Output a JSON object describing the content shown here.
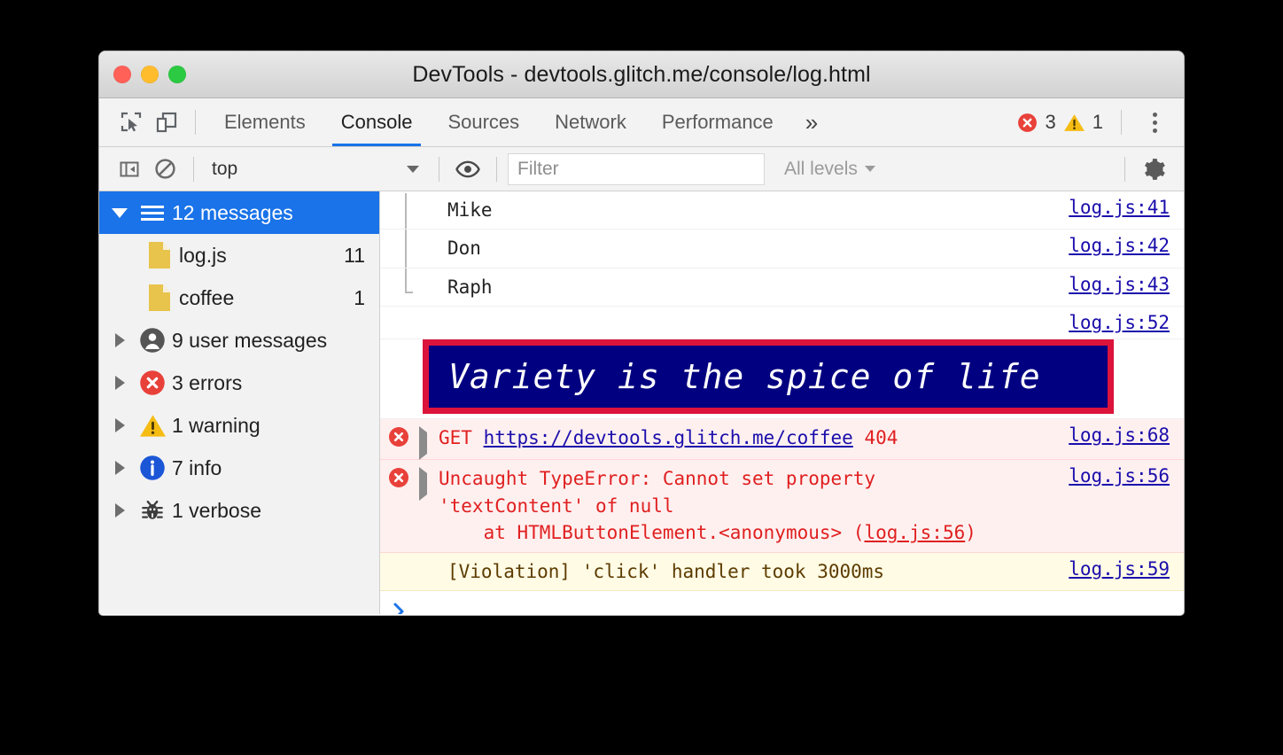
{
  "window": {
    "title": "DevTools - devtools.glitch.me/console/log.html",
    "traffic_lights": [
      {
        "name": "close",
        "color": "#ff6159"
      },
      {
        "name": "minimize",
        "color": "#ffbd2e"
      },
      {
        "name": "zoom",
        "color": "#2bca42"
      }
    ]
  },
  "toolbar": {
    "inspect_icon": "inspect-element-icon",
    "device_icon": "device-toolbar-icon",
    "tabs": [
      {
        "label": "Elements",
        "active": false
      },
      {
        "label": "Console",
        "active": true
      },
      {
        "label": "Sources",
        "active": false
      },
      {
        "label": "Network",
        "active": false
      },
      {
        "label": "Performance",
        "active": false
      }
    ],
    "more_tabs_label": "»",
    "error_count": "3",
    "warning_count": "1",
    "menu_icon": "kebab-menu-icon",
    "active_tab_underline_color": "#1a73e8"
  },
  "filterbar": {
    "sidebar_toggle_icon": "sidebar-toggle-icon",
    "clear_console_icon": "clear-console-icon",
    "context": "top",
    "eye_icon": "live-expression-eye-icon",
    "filter_placeholder": "Filter",
    "filter_value": "",
    "levels": "All levels",
    "settings_icon": "settings-gear-icon"
  },
  "sidebar": {
    "root": {
      "label": "12 messages",
      "icon": "list-icon",
      "selected": true,
      "expanded": true
    },
    "files": [
      {
        "label": "log.js",
        "count": "11",
        "icon": "file-icon"
      },
      {
        "label": "coffee",
        "count": "1",
        "icon": "file-icon"
      }
    ],
    "groups": [
      {
        "label": "9 user messages",
        "icon": "person-icon"
      },
      {
        "label": "3 errors",
        "icon": "error-icon"
      },
      {
        "label": "1 warning",
        "icon": "warning-icon"
      },
      {
        "label": "7 info",
        "icon": "info-icon"
      },
      {
        "label": "1 verbose",
        "icon": "bug-icon"
      }
    ]
  },
  "console": {
    "grouped_messages": [
      {
        "text": "Mike",
        "source": "log.js:41"
      },
      {
        "text": "Don",
        "source": "log.js:42"
      },
      {
        "text": "Raph",
        "source": "log.js:43"
      }
    ],
    "styled_message": {
      "text": "Variety is the spice of life",
      "source": "log.js:52",
      "border_color": "#dc143c",
      "background_color": "#000080",
      "text_color": "#ffffff"
    },
    "errors": [
      {
        "method": "GET",
        "url": "https://devtools.glitch.me/coffee",
        "status": "404",
        "source": "log.js:68"
      },
      {
        "line1": "Uncaught TypeError: Cannot set property",
        "line2": "'textContent' of null",
        "line3_prefix": "    at HTMLButtonElement.<anonymous> (",
        "line3_link": "log.js:56",
        "line3_suffix": ")",
        "source": "log.js:56"
      }
    ],
    "violation": {
      "text": "[Violation] 'click' handler took 3000ms",
      "source": "log.js:59"
    },
    "prompt_symbol": "›"
  }
}
